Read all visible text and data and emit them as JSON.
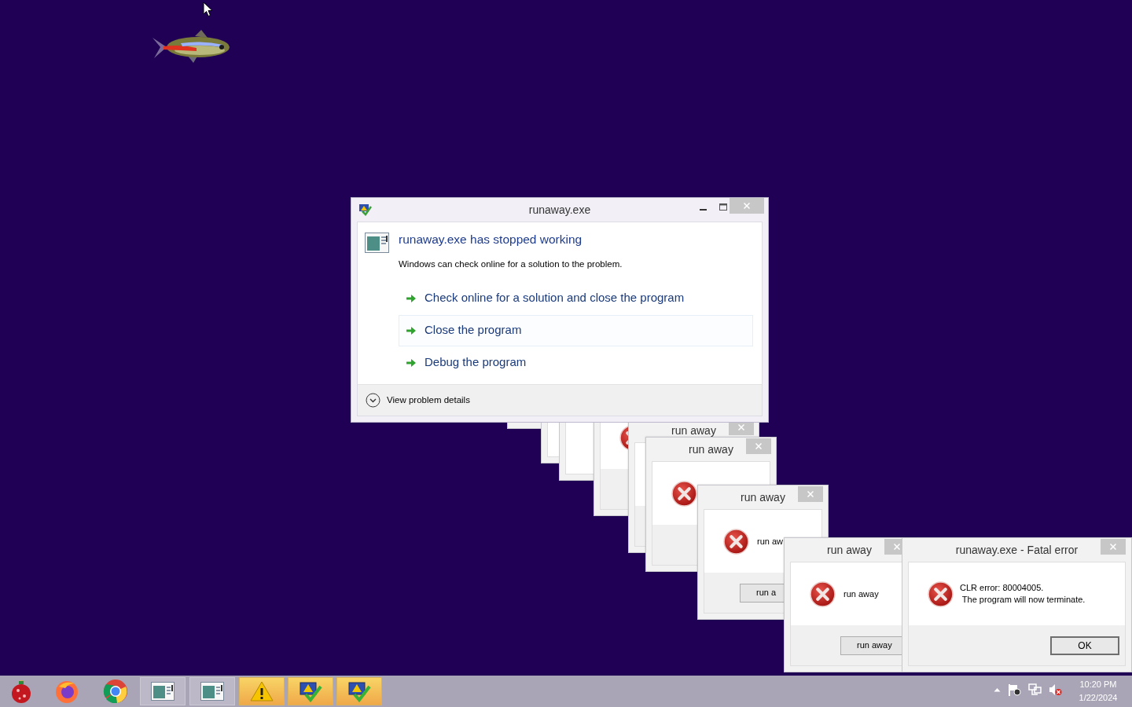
{
  "error_report": {
    "title": "runaway.exe",
    "heading": "runaway.exe has stopped working",
    "description": "Windows can check online for a solution to the problem.",
    "options": [
      {
        "label": "Check online for a solution and close the program",
        "highlighted": false
      },
      {
        "label": "Close the program",
        "highlighted": true
      },
      {
        "label": "Debug the program",
        "highlighted": false
      }
    ],
    "details_toggle": "View problem details"
  },
  "run_away_dialogs": [
    {
      "error_icon": true
    },
    {
      "title": "run away"
    },
    {
      "title": "run away",
      "error_icon": true
    },
    {
      "title": "run away",
      "error_icon": true,
      "message": "run aw",
      "button": "run a"
    },
    {
      "title": "run away",
      "error_icon": true,
      "message": "run away",
      "button": "run away"
    }
  ],
  "fatal_error": {
    "title": "runaway.exe - Fatal error",
    "message": "CLR error: 80004005.\n The program will now terminate.",
    "button": "OK"
  },
  "taskbar": {
    "items": [
      {
        "kind": "ornament",
        "running": false,
        "flashing": false
      },
      {
        "kind": "fox-browser",
        "running": false,
        "flashing": false
      },
      {
        "kind": "round-browser",
        "running": false,
        "flashing": false
      },
      {
        "kind": "app-window",
        "running": true,
        "flashing": false
      },
      {
        "kind": "app-window",
        "running": true,
        "flashing": false
      },
      {
        "kind": "warning",
        "running": true,
        "flashing": true
      },
      {
        "kind": "monitor-warning",
        "running": true,
        "flashing": true
      },
      {
        "kind": "monitor-warning",
        "running": true,
        "flashing": true
      }
    ],
    "tray": [
      {
        "kind": "show-hidden"
      },
      {
        "kind": "flag"
      },
      {
        "kind": "network"
      },
      {
        "kind": "volume-muted"
      }
    ],
    "clock": {
      "time": "10:20 PM",
      "date": "1/22/2024"
    }
  }
}
